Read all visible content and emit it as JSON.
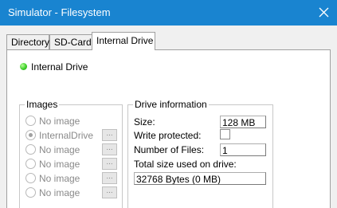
{
  "window": {
    "title": "Simulator - Filesystem",
    "close_icon": "close-icon"
  },
  "tabs": [
    {
      "label": "Directory"
    },
    {
      "label": "SD-Card"
    },
    {
      "label": "Internal Drive",
      "active": true
    }
  ],
  "drive_status": {
    "label": "Internal Drive",
    "led_color": "#3fd02a"
  },
  "images": {
    "legend": "Images",
    "items": [
      {
        "label": "No image",
        "selected": false,
        "browse_label": "..."
      },
      {
        "label": "InternalDrive",
        "selected": true,
        "browse_label": "..."
      },
      {
        "label": "No image",
        "selected": false,
        "browse_label": "..."
      },
      {
        "label": "No image",
        "selected": false,
        "browse_label": "..."
      },
      {
        "label": "No image",
        "selected": false,
        "browse_label": "..."
      },
      {
        "label": "No image",
        "selected": false,
        "browse_label": "..."
      }
    ]
  },
  "drive_info": {
    "legend": "Drive information",
    "size_label": "Size:",
    "size_value": "128 MB",
    "write_protected_label": "Write protected:",
    "write_protected": false,
    "number_of_files_label": "Number of Files:",
    "number_of_files_value": "1",
    "total_size_label": "Total size used on drive:",
    "total_size_value": "32768 Bytes (0 MB)"
  },
  "colors": {
    "titlebar": "#1984d0",
    "window_bg": "#f0f0f0",
    "panel_bg": "#ffffff",
    "disabled_text": "#8a8a8a"
  }
}
